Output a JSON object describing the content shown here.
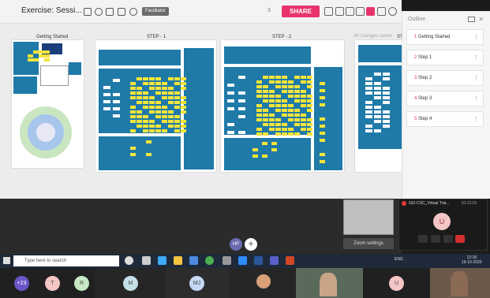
{
  "toolbar": {
    "board_title": "Exercise: Sessi...",
    "facilitator_label": "Facilitator",
    "users_count": "3",
    "share_label": "SHARE"
  },
  "board": {
    "frames": [
      {
        "title": "Getting Started"
      },
      {
        "title": "STEP - 1"
      },
      {
        "title": "STEP - 2"
      },
      {
        "title": "ST"
      }
    ],
    "changes_saved": "All changes saved"
  },
  "outline": {
    "title": "Outline",
    "items": [
      {
        "label": "Getting Started",
        "number": "1"
      },
      {
        "label": "Step 1",
        "number": "2"
      },
      {
        "label": "Step 2",
        "number": "3"
      },
      {
        "label": "Step 3",
        "number": "4"
      },
      {
        "label": "Step 4",
        "number": "5"
      }
    ]
  },
  "canvas": {
    "zoom_settings_label": "Zoom settings",
    "presence_avatar": "HP",
    "add_label": "+"
  },
  "call": {
    "title": "GIZ-CSC_Virtual Trai...",
    "time": "01:21:01",
    "avatar": "U"
  },
  "taskbar": {
    "search_placeholder": "Type here to search",
    "tray": "ENG",
    "time": "12:18",
    "date": "16-10-2020"
  },
  "participants": [
    {
      "label": "+23",
      "color": "#6b55c8"
    },
    {
      "label": "T",
      "color": "#f5c6c6"
    },
    {
      "label": "R",
      "color": "#c6e8c6"
    },
    {
      "label": "M",
      "color": "#c6e0e8"
    },
    {
      "label": "MJ",
      "color": "#c6d8f5"
    },
    {
      "label": "U",
      "color": "#f5c6c6"
    }
  ],
  "colors": {
    "accent": "#e8336b",
    "panel_blue": "#1f7aa8",
    "sticky_yellow": "#f5e43a"
  }
}
